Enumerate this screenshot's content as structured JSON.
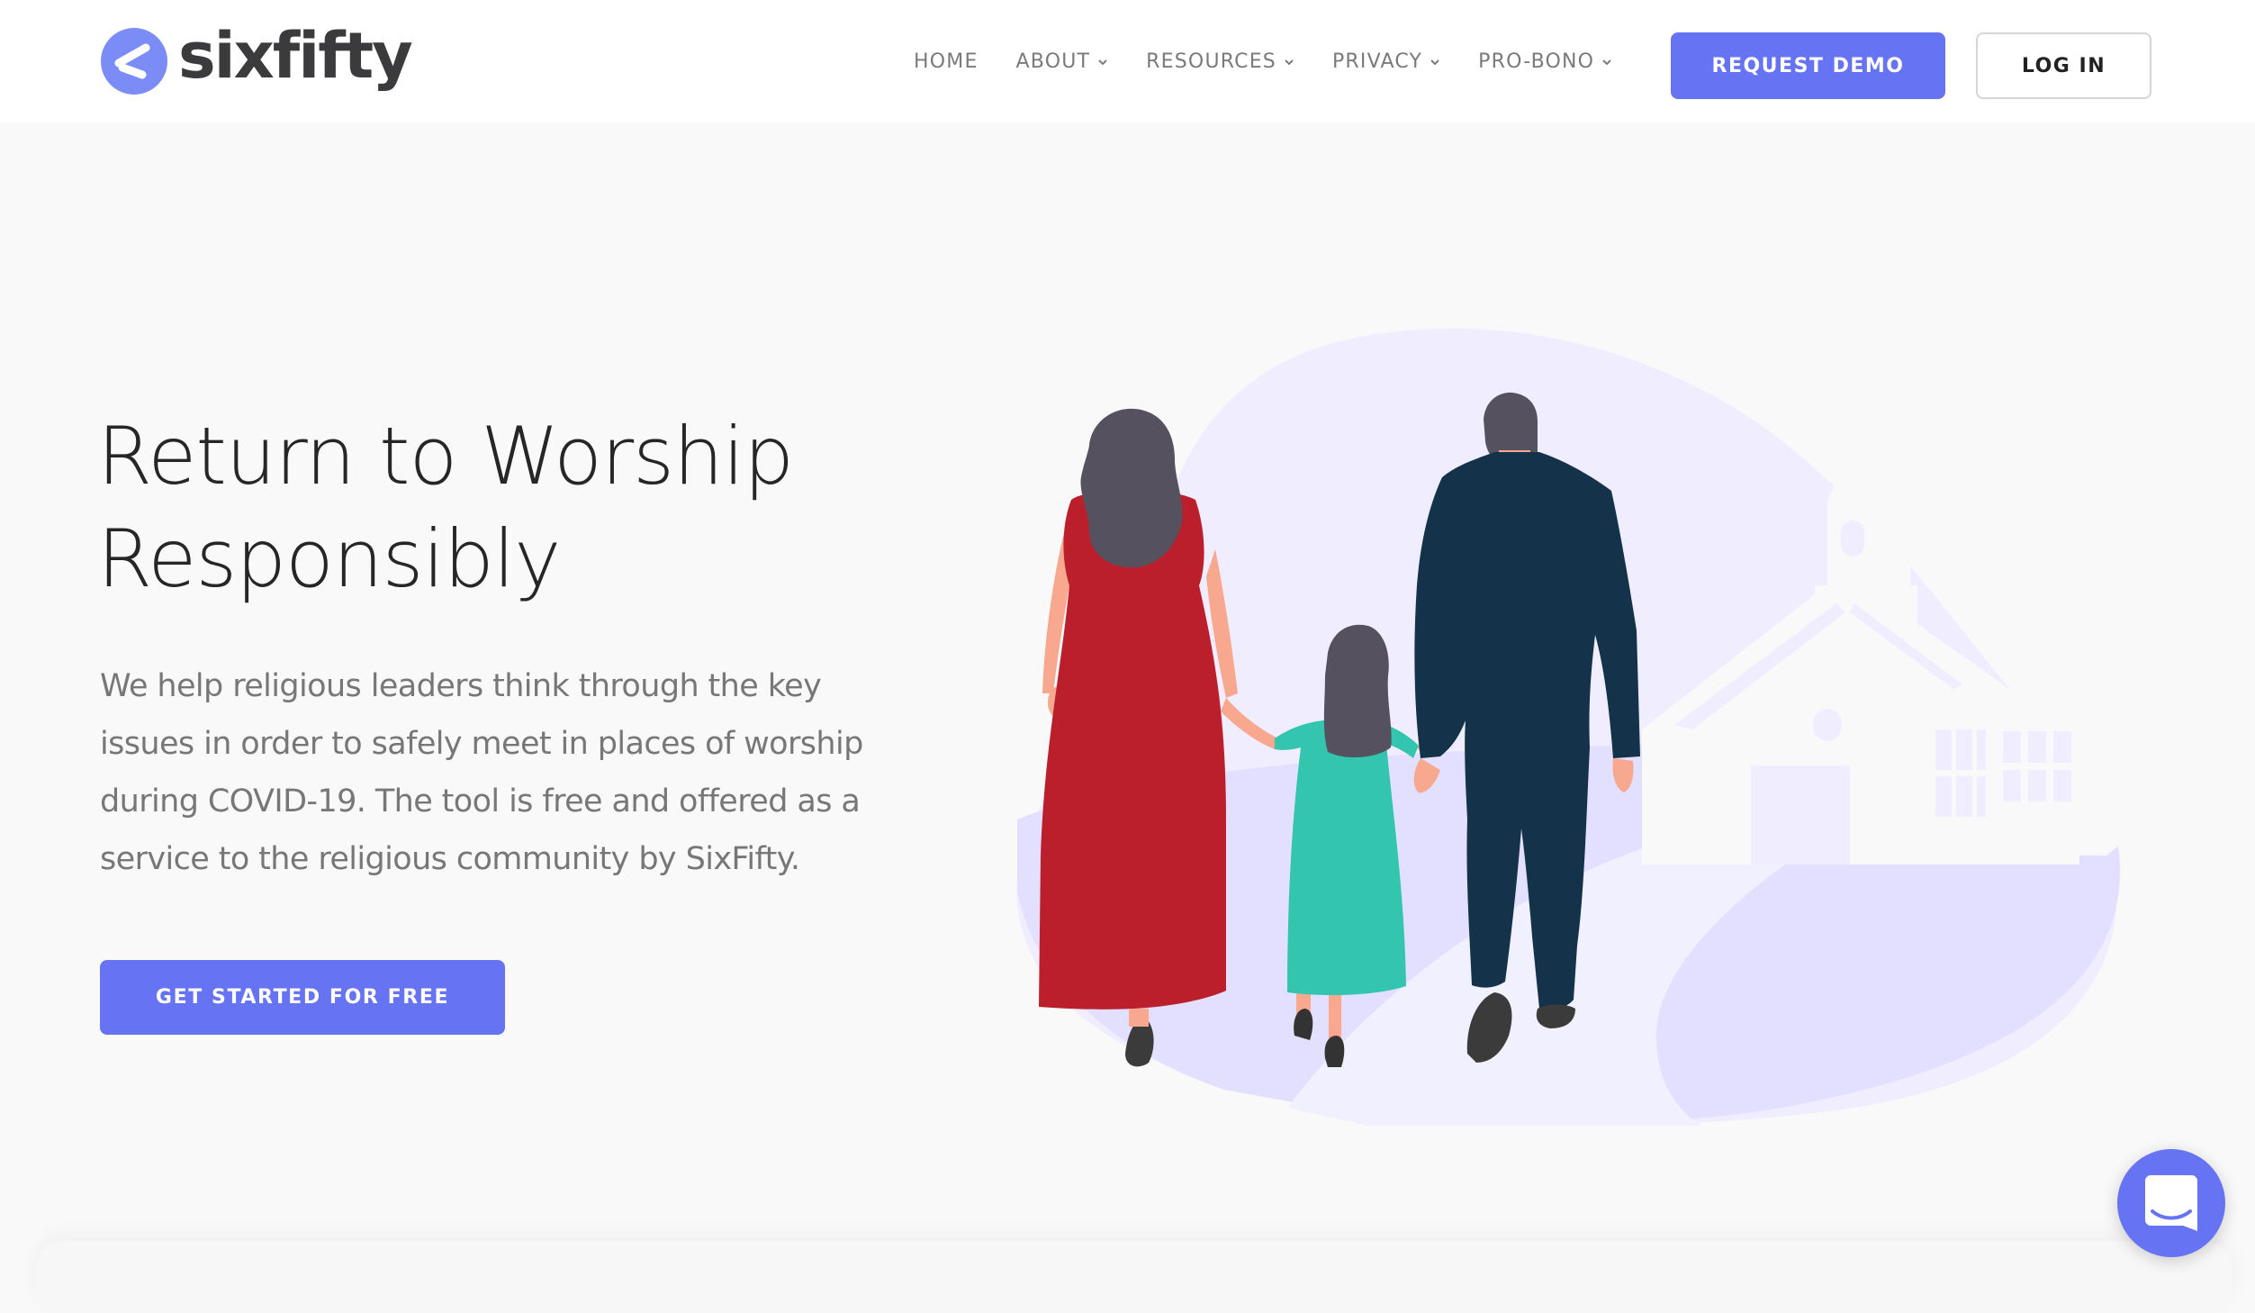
{
  "brand": {
    "name": "sixfifty",
    "logo_icon": "chevron-left-bubble-icon",
    "accent_color": "#6673f3",
    "logo_circle_color": "#7b8cf6"
  },
  "nav": {
    "items": [
      {
        "label": "HOME",
        "has_dropdown": false
      },
      {
        "label": "ABOUT",
        "has_dropdown": true
      },
      {
        "label": "RESOURCES",
        "has_dropdown": true
      },
      {
        "label": "PRIVACY",
        "has_dropdown": true
      },
      {
        "label": "PRO-BONO",
        "has_dropdown": true
      }
    ],
    "request_demo_label": "REQUEST DEMO",
    "login_label": "LOG IN"
  },
  "hero": {
    "title_lines": [
      "Return to Worship",
      "Responsibly"
    ],
    "description_lines": [
      "We help religious leaders think through the key",
      "issues in order to safely meet in places of worship",
      "during COVID-19. The tool is free and offered as a",
      "service to the religious community by SixFifty."
    ],
    "cta_label": "GET STARTED FOR FREE",
    "illustration": "family-walking-to-church-illustration"
  },
  "chat": {
    "icon": "chat-smile-icon"
  }
}
